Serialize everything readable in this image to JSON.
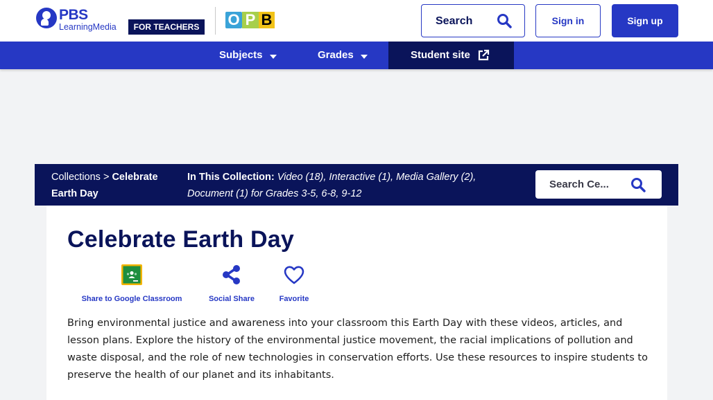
{
  "header": {
    "logo_primary": "PBS",
    "logo_secondary": "LearningMedia",
    "audience_badge": "FOR TEACHERS",
    "partner_logo": "OPB",
    "search_label": "Search",
    "signin_label": "Sign in",
    "signup_label": "Sign up"
  },
  "nav": {
    "items": [
      {
        "label": "Subjects",
        "icon": "caret-down-icon"
      },
      {
        "label": "Grades",
        "icon": "caret-down-icon"
      },
      {
        "label": "Student site",
        "icon": "external-link-icon"
      }
    ]
  },
  "collection_bar": {
    "breadcrumb_root": "Collections",
    "breadcrumb_sep": " > ",
    "breadcrumb_current": "Celebrate Earth Day",
    "in_collection_label": "In This Collection:",
    "in_collection_value": "Video (18), Interactive (1), Media Gallery (2), Document (1) for Grades 3-5, 6-8, 9-12",
    "search_placeholder": "Search Ce..."
  },
  "content": {
    "title": "Celebrate Earth Day",
    "actions": [
      {
        "label": "Share to Google Classroom",
        "icon": "google-classroom-icon"
      },
      {
        "label": "Social Share",
        "icon": "share-icon"
      },
      {
        "label": "Favorite",
        "icon": "heart-icon"
      }
    ],
    "description": "Bring environmental justice and awareness into your classroom this Earth Day with these videos, articles, and lesson plans. Explore the history of the environmental justice movement, the racial implications of pollution and waste disposal, and the role of new technologies in conservation efforts. Use these resources to inspire students to preserve the health of our planet and its inhabitants."
  },
  "colors": {
    "brand_blue": "#2638c4",
    "navy": "#0a145a",
    "google_classroom_green": "#1e8e3e"
  }
}
